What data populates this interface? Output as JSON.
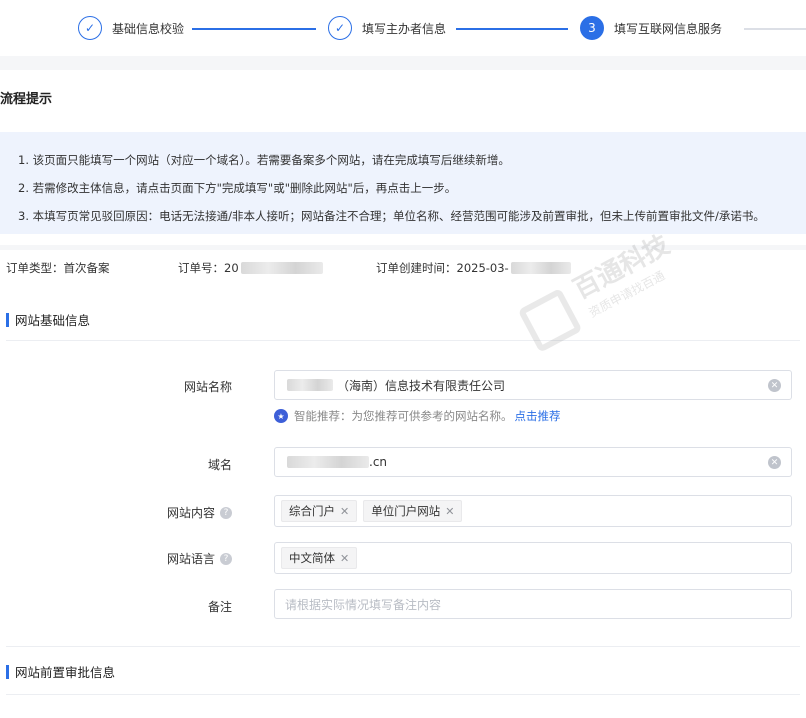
{
  "steps": [
    {
      "label": "基础信息校验",
      "status": "done",
      "marker": "✓"
    },
    {
      "label": "填写主办者信息",
      "status": "done",
      "marker": "✓"
    },
    {
      "label": "填写互联网信息服务",
      "status": "active",
      "marker": "3"
    }
  ],
  "tips": {
    "title": "流程提示",
    "lines": [
      "1. 该页面只能填写一个网站（对应一个域名）。若需要备案多个网站，请在完成填写后继续新增。",
      "2. 若需修改主体信息，请点击页面下方\"完成填写\"或\"删除此网站\"后，再点击上一步。",
      "3. 本填写页常见驳回原因：电话无法接通/非本人接听；网站备注不合理；单位名称、经营范围可能涉及前置审批，但未上传前置审批文件/承诺书。"
    ]
  },
  "order": {
    "type_label": "订单类型：",
    "type_value": "首次备案",
    "number_label": "订单号：",
    "number_value": "20",
    "created_label": "订单创建时间：",
    "created_value": "2025-03-"
  },
  "watermark": {
    "text": "百通科技",
    "sub": "资质申请找百通"
  },
  "website_basic": {
    "section_title": "网站基础信息",
    "name": {
      "label": "网站名称",
      "value": "（海南）信息技术有限责任公司"
    },
    "suggest": {
      "prefix": "智能推荐：为您推荐可供参考的网站名称。",
      "link": "点击推荐"
    },
    "domain": {
      "label": "域名",
      "value": ".cn"
    },
    "content": {
      "label": "网站内容",
      "tags": [
        "综合门户",
        "单位门户网站"
      ]
    },
    "language": {
      "label": "网站语言",
      "tags": [
        "中文简体"
      ]
    },
    "remark": {
      "label": "备注",
      "placeholder": "请根据实际情况填写备注内容"
    }
  },
  "pre_approval": {
    "section_title": "网站前置审批信息"
  },
  "icons": {
    "check": "check-icon",
    "clear": "clear-icon",
    "help": "help-icon",
    "tag_close": "close-icon",
    "suggest": "star-icon"
  },
  "colors": {
    "primary": "#2b6fe6",
    "tip_bg": "#eef3fd"
  }
}
